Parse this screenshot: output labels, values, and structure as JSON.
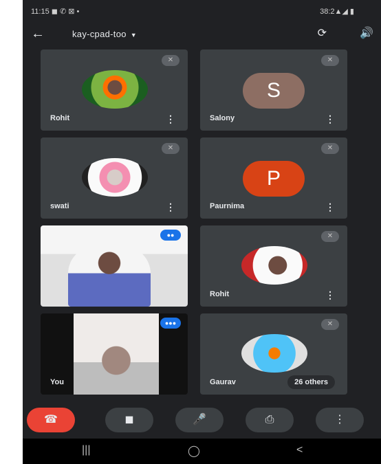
{
  "status_bar": {
    "left": "11:15 ◼ ✆ ⊠ •",
    "right": "38:2▲◢ ▮"
  },
  "appbar": {
    "title": "kay-cpad-too",
    "back_icon": "←",
    "camera_switch_icon": "⟳",
    "speaker_icon": "🔊"
  },
  "participants": [
    {
      "name": "Rohit"
    },
    {
      "name": "Salony",
      "initial": "S",
      "color": "#8d6e63"
    },
    {
      "name": "swati"
    },
    {
      "name": "Paurnima",
      "initial": "P",
      "color": "#d84315"
    },
    {
      "name": ""
    },
    {
      "name": "Rohit"
    },
    {
      "name": "You"
    },
    {
      "name": "Gaurav"
    }
  ],
  "others_label": "26 others",
  "controls": {
    "end_icon": "☎",
    "camera_icon": "◼",
    "mic_icon": "🎤",
    "present_icon": "⎙",
    "more_icon": "⋮"
  },
  "navbar": {
    "recent": "|||",
    "home": "◯",
    "back": "<"
  }
}
